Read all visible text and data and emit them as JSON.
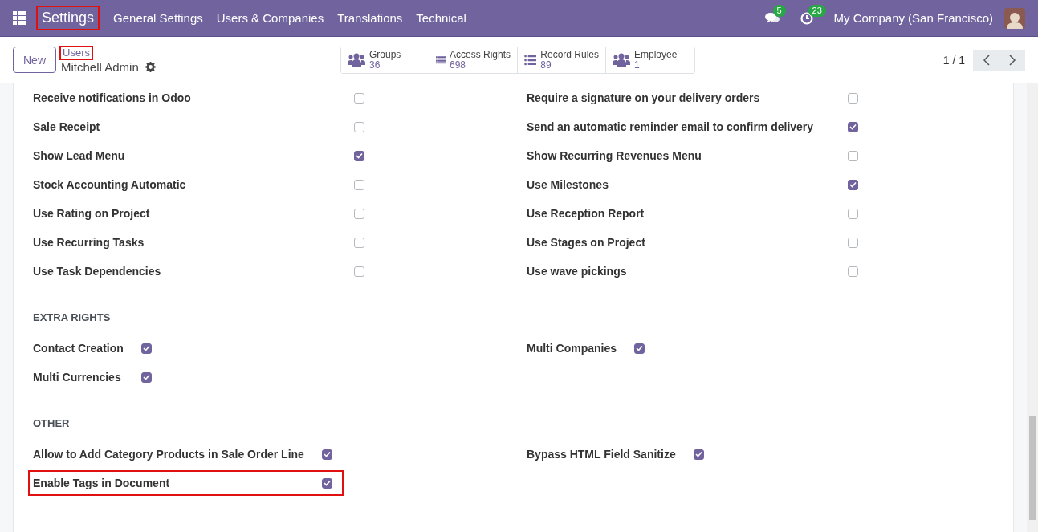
{
  "navbar": {
    "app_name": "Settings",
    "app_highlighted": true,
    "menus": [
      "General Settings",
      "Users & Companies",
      "Translations",
      "Technical"
    ],
    "messages_badge": "5",
    "activities_badge": "23",
    "company": "My Company (San Francisco)"
  },
  "control_panel": {
    "new_button": "New",
    "breadcrumb": "Users",
    "breadcrumb_highlighted": true,
    "record_title": "Mitchell Admin",
    "pager": "1 / 1",
    "smart_buttons": [
      {
        "kind": "users",
        "label": "Groups",
        "value": "36"
      },
      {
        "kind": "list",
        "label": "Access Rights",
        "value": "698"
      },
      {
        "kind": "list-ul",
        "label": "Record Rules",
        "value": "89"
      },
      {
        "kind": "users",
        "label": "Employee",
        "value": "1"
      }
    ]
  },
  "sections": [
    {
      "kind": "wide",
      "columns": [
        [
          {
            "label": "Receive notifications in Odoo",
            "checked": false,
            "highlighted": false
          },
          {
            "label": "Sale Receipt",
            "checked": false,
            "highlighted": false
          },
          {
            "label": "Show Lead Menu",
            "checked": true,
            "highlighted": false
          },
          {
            "label": "Stock Accounting Automatic",
            "checked": false,
            "highlighted": false
          },
          {
            "label": "Use Rating on Project",
            "checked": false,
            "highlighted": false
          },
          {
            "label": "Use Recurring Tasks",
            "checked": false,
            "highlighted": false
          },
          {
            "label": "Use Task Dependencies",
            "checked": false,
            "highlighted": false
          }
        ],
        [
          {
            "label": "Require a signature on your delivery orders",
            "checked": false,
            "highlighted": false
          },
          {
            "label": "Send an automatic reminder email to confirm delivery",
            "checked": true,
            "highlighted": false
          },
          {
            "label": "Show Recurring Revenues Menu",
            "checked": false,
            "highlighted": false
          },
          {
            "label": "Use Milestones",
            "checked": true,
            "highlighted": false
          },
          {
            "label": "Use Reception Report",
            "checked": false,
            "highlighted": false
          },
          {
            "label": "Use Stages on Project",
            "checked": false,
            "highlighted": false
          },
          {
            "label": "Use wave pickings",
            "checked": false,
            "highlighted": false
          }
        ]
      ]
    },
    {
      "title": "EXTRA RIGHTS",
      "kind": "compact",
      "columns": [
        [
          {
            "label": "Contact Creation",
            "checked": true,
            "highlighted": false
          },
          {
            "label": "Multi Currencies",
            "checked": true,
            "highlighted": false
          }
        ],
        [
          {
            "label": "Multi Companies",
            "checked": true,
            "highlighted": false
          }
        ]
      ]
    },
    {
      "title": "OTHER",
      "kind": "compact",
      "columns": [
        [
          {
            "label": "Allow to Add Category Products in Sale Order Line",
            "checked": true,
            "highlighted": false
          },
          {
            "label": "Enable Tags in Document",
            "checked": true,
            "highlighted": true
          }
        ],
        [
          {
            "label": "Bypass HTML Field Sanitize",
            "checked": true,
            "highlighted": false
          }
        ]
      ]
    }
  ]
}
